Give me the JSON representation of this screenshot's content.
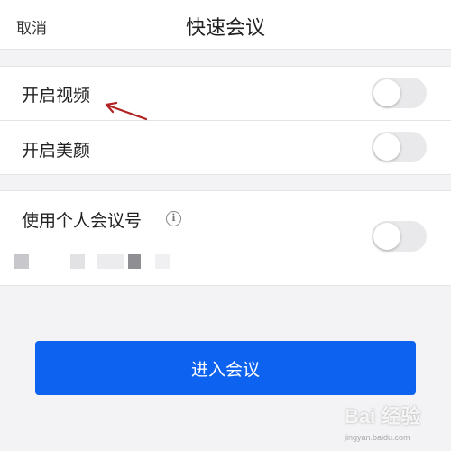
{
  "header": {
    "cancel_label": "取消",
    "title": "快速会议"
  },
  "settings": {
    "group1": [
      {
        "label": "开启视频",
        "enabled": false
      },
      {
        "label": "开启美颜",
        "enabled": false
      }
    ],
    "group2": {
      "label": "使用个人会议号",
      "info_icon": "i",
      "enabled": false
    }
  },
  "enter_button": {
    "label": "进入会议"
  },
  "watermark": {
    "text": "Bai 经验",
    "sub": "jingyan.baidu.com"
  },
  "colors": {
    "accent": "#0d62ef",
    "annotation_arrow": "#b22222",
    "toggle_off": "#e9e9eb"
  }
}
